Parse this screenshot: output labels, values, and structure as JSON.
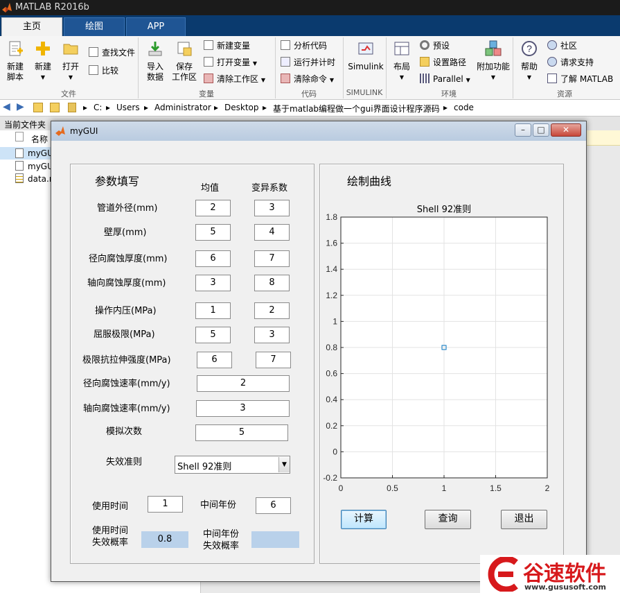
{
  "app": {
    "title": "MATLAB R2016b"
  },
  "tabs": [
    {
      "label": "主页",
      "active": true
    },
    {
      "label": "绘图",
      "active": false
    },
    {
      "label": "APP",
      "active": false
    }
  ],
  "ribbon": {
    "new_script_line1": "新建",
    "new_script_line2": "脚本",
    "new": "新建",
    "open": "打开",
    "find_files": "查找文件",
    "compare": "比较",
    "import_line1": "导入",
    "import_line2": "数据",
    "save_ws_line1": "保存",
    "save_ws_line2": "工作区",
    "new_variable": "新建变量",
    "open_variable": "打开变量",
    "clear_workspace": "清除工作区",
    "analyze_code": "分析代码",
    "run_and_time": "运行并计时",
    "clear_commands": "清除命令",
    "simulink": "Simulink",
    "layout": "布局",
    "preferences": "预设",
    "set_path": "设置路径",
    "parallel": "Parallel",
    "addons": "附加功能",
    "help": "帮助",
    "community": "社区",
    "request_support": "请求支持",
    "learn_matlab": "了解 MATLAB",
    "section_file": "文件",
    "section_variable": "变量",
    "section_code": "代码",
    "section_simulink": "SIMULINK",
    "section_env": "环境",
    "section_resources": "资源"
  },
  "path": [
    "C:",
    "Users",
    "Administrator",
    "Desktop",
    "基于matlab编程做一个gui界面设计程序源码",
    "code"
  ],
  "left_panel": {
    "header": "当前文件夹",
    "col_name": "名称",
    "files": [
      "myGUI",
      "myGUI",
      "data.m"
    ]
  },
  "window": {
    "title": "myGUI"
  },
  "params": {
    "title": "参数填写",
    "col_mean": "均值",
    "col_cv": "变异系数",
    "rows": [
      {
        "label": "管道外径(mm)",
        "mean": "2",
        "cv": "3"
      },
      {
        "label": "壁厚(mm)",
        "mean": "5",
        "cv": "4"
      },
      {
        "label": "径向腐蚀厚度(mm)",
        "mean": "6",
        "cv": "7"
      },
      {
        "label": "轴向腐蚀厚度(mm)",
        "mean": "3",
        "cv": "8"
      },
      {
        "label": "操作内压(MPa)",
        "mean": "1",
        "cv": "2"
      },
      {
        "label": "屈服极限(MPa)",
        "mean": "5",
        "cv": "3"
      },
      {
        "label": "极限抗拉伸强度(MPa)",
        "mean": "6",
        "cv": "7"
      }
    ],
    "radial_rate_label": "径向腐蚀速率(mm/y)",
    "radial_rate": "2",
    "axial_rate_label": "轴向腐蚀速率(mm/y)",
    "axial_rate": "3",
    "sim_count_label": "模拟次数",
    "sim_count": "5",
    "criterion_label": "失效准则",
    "criterion_value": "Shell 92准则",
    "use_time_label": "使用时间",
    "use_time": "1",
    "mid_year_label": "中间年份",
    "mid_year": "6",
    "use_time_prob_line1": "使用时间",
    "use_time_prob_line2": "失效概率",
    "use_time_prob": "0.8",
    "mid_year_prob_line1": "中间年份",
    "mid_year_prob_line2": "失效概率",
    "mid_year_prob": ""
  },
  "plot_panel": {
    "title": "绘制曲线"
  },
  "chart_data": {
    "type": "scatter",
    "title": "Shell 92准则",
    "xlim": [
      0,
      2
    ],
    "ylim": [
      -0.2,
      1.8
    ],
    "xticks": [
      0,
      0.5,
      1,
      1.5,
      2
    ],
    "xtick_labels": [
      "0",
      "0.5",
      "1",
      "1.5",
      "2"
    ],
    "yticks": [
      -0.2,
      0,
      0.2,
      0.4,
      0.6,
      0.8,
      1,
      1.2,
      1.4,
      1.6,
      1.8
    ],
    "ytick_labels": [
      "-0.2",
      "0",
      "0.2",
      "0.4",
      "0.6",
      "0.8",
      "1",
      "1.2",
      "1.4",
      "1.6",
      "1.8"
    ],
    "grid": true,
    "points": [
      {
        "x": 1,
        "y": 0.8
      }
    ],
    "marker_color": "#0072bd"
  },
  "buttons": {
    "compute": "计算",
    "query": "查询",
    "exit": "退出"
  },
  "watermark": {
    "brand": "谷速软件",
    "url": "www.gususoft.com",
    "color": "#d7191c"
  }
}
